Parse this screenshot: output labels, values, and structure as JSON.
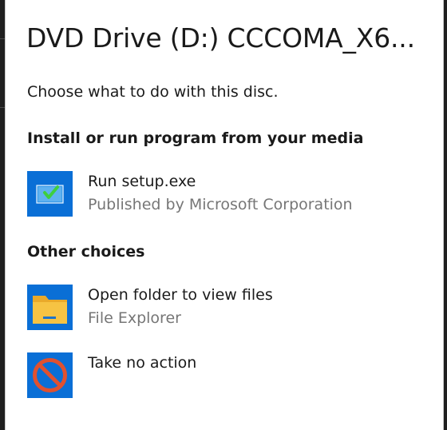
{
  "dialog": {
    "title": "DVD Drive (D:) CCCOMA_X6...",
    "prompt": "Choose what to do with this disc."
  },
  "sections": [
    {
      "heading": "Install or run program from your media",
      "options": [
        {
          "label": "Run setup.exe",
          "sublabel": "Published by Microsoft Corporation",
          "icon": "setup-installer-icon"
        }
      ]
    },
    {
      "heading": "Other choices",
      "options": [
        {
          "label": "Open folder to view files",
          "sublabel": "File Explorer",
          "icon": "folder-icon"
        },
        {
          "label": "Take no action",
          "sublabel": "",
          "icon": "no-action-icon"
        }
      ]
    }
  ],
  "colors": {
    "tile_blue": "#0a6fd6",
    "panel_bg": "#ffffff",
    "secondary_text": "#767676",
    "folder_yellow": "#f6c343",
    "no_action_red": "#e0512f"
  }
}
